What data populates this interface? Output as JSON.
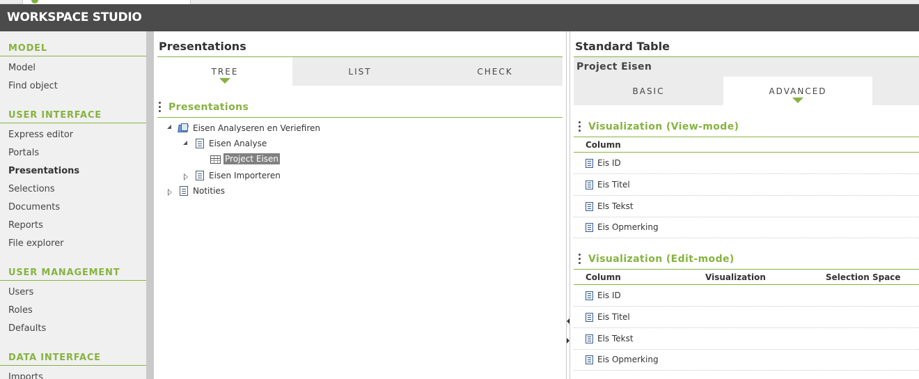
{
  "app": {
    "title": "WORKSPACE STUDIO"
  },
  "sidebar": {
    "sections": [
      {
        "label": "MODEL",
        "items": [
          "Model",
          "Find object"
        ]
      },
      {
        "label": "USER INTERFACE",
        "items": [
          "Express editor",
          "Portals",
          "Presentations",
          "Selections",
          "Documents",
          "Reports",
          "File explorer"
        ]
      },
      {
        "label": "USER MANAGEMENT",
        "items": [
          "Users",
          "Roles",
          "Defaults"
        ]
      },
      {
        "label": "DATA INTERFACE",
        "items": [
          "Imports"
        ]
      }
    ],
    "active_item": "Presentations"
  },
  "presentations_panel": {
    "title": "Presentations",
    "tabs": [
      "TREE",
      "LIST",
      "CHECK"
    ],
    "active_tab": "TREE",
    "section_title": "Presentations",
    "tree": [
      {
        "label": "Eisen Analyseren en Veriefiren",
        "icon": "folder-icon",
        "expanded": true
      },
      {
        "label": "Eisen Analyse",
        "icon": "document-icon",
        "expanded": true
      },
      {
        "label": "Project Eisen",
        "icon": "table-icon",
        "selected": true
      },
      {
        "label": "Eisen Importeren",
        "icon": "document-icon",
        "expanded": false
      },
      {
        "label": "Notities",
        "icon": "document-icon",
        "expanded": false
      }
    ]
  },
  "detail_panel": {
    "title": "Standard Table",
    "subtitle": "Project Eisen",
    "tabs": [
      "BASIC",
      "ADVANCED"
    ],
    "active_tab": "ADVANCED",
    "view_mode": {
      "title": "Visualization (View-mode)",
      "columns": [
        "Column"
      ],
      "rows": [
        "Eis ID",
        "Eis Titel",
        "Els Tekst",
        "Eis Opmerking"
      ]
    },
    "edit_mode": {
      "title": "Visualization (Edit-mode)",
      "columns": [
        "Column",
        "Visualization",
        "Selection Space"
      ],
      "rows": [
        "Eis ID",
        "Eis Titel",
        "Els Tekst",
        "Eis Opmerking"
      ]
    }
  },
  "colors": {
    "accent": "#86b340",
    "header": "#4b4b4b",
    "sidebar": "#f0f0f0"
  }
}
